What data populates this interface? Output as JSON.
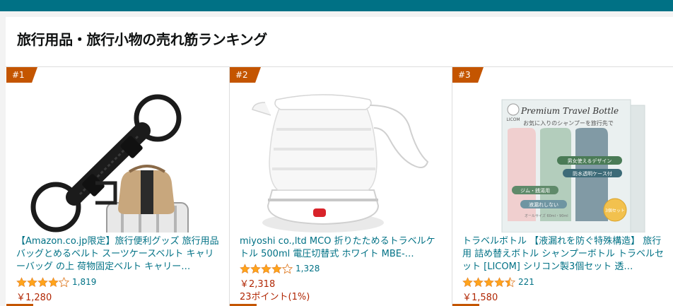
{
  "section": {
    "title": "旅行用品・旅行小物の売れ筋ランキング"
  },
  "products": [
    {
      "rank": "#1",
      "title": "【Amazon.co.jp限定】旅行便利グッズ 旅行用品 バッグとめるベルト スーツケースベルト キャリーバッグ の上 荷物固定ベルト キャリー…",
      "rating": 4.0,
      "review_count": "1,819",
      "price": "￥1,280",
      "image_icon": "luggage-strap"
    },
    {
      "rank": "#2",
      "title": "miyoshi co.,ltd MCO 折りたためるトラベルケトル 500ml 電圧切替式 ホワイト MBE-…",
      "rating": 4.0,
      "review_count": "1,328",
      "price": "￥2,318",
      "points": "23ポイント(1%)",
      "image_icon": "folding-kettle"
    },
    {
      "rank": "#3",
      "title": "トラベルボトル 【液漏れを防ぐ特殊構造】 旅行用 詰め替えボトル シャンプーボトル トラベルセット [LICOM] シリコン製3個セット 透…",
      "rating": 4.5,
      "review_count": "221",
      "price": "￥1,580",
      "image_icon": "travel-bottle-set",
      "image_text": {
        "brand": "LICOM",
        "headline": "Premium Travel Bottle",
        "subline": "お気に入りのシャンプーを旅行先で",
        "tag1": "男女使えるデザイン",
        "tag2": "防水透明ケース付",
        "tag3": "ジム・銭湯用",
        "tag4": "液漏れしない",
        "size": "オールサイズ 60ml・90ml",
        "badge": "3個セット"
      }
    }
  ],
  "colors": {
    "accent_bar": "#007185",
    "rank_badge": "#c45500",
    "link": "#007185",
    "price": "#B12704",
    "star": "#FFA41C"
  }
}
